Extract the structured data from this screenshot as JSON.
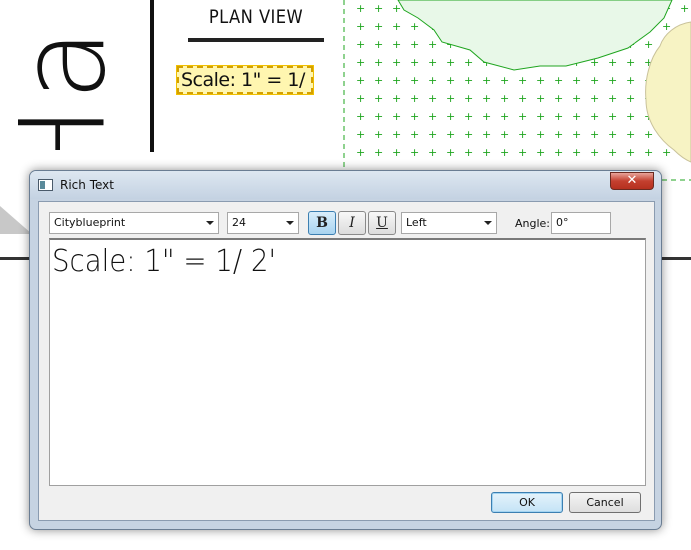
{
  "drawing": {
    "vertical_title": "Ha",
    "plan_view": "PLAN VIEW",
    "scale_label": "Scale: 1\" = 1/ 2'"
  },
  "dialog": {
    "title": "Rich Text",
    "close_glyph": "✕",
    "toolbar": {
      "font": "Cityblueprint",
      "size": "24",
      "bold_label": "B",
      "italic_label": "I",
      "underline_label": "U",
      "alignment": "Left",
      "angle_label": "Angle:",
      "angle_value": "0°"
    },
    "editor_text": "Scale: 1\" = 1/ 2'",
    "ok_label": "OK",
    "cancel_label": "Cancel"
  },
  "colors": {
    "site_green": "#1fa51f",
    "site_fill": "#e8f8e8",
    "tree_fill": "#f7f3c4",
    "selection": "#fff6b0",
    "close_red": "#c4402f"
  }
}
